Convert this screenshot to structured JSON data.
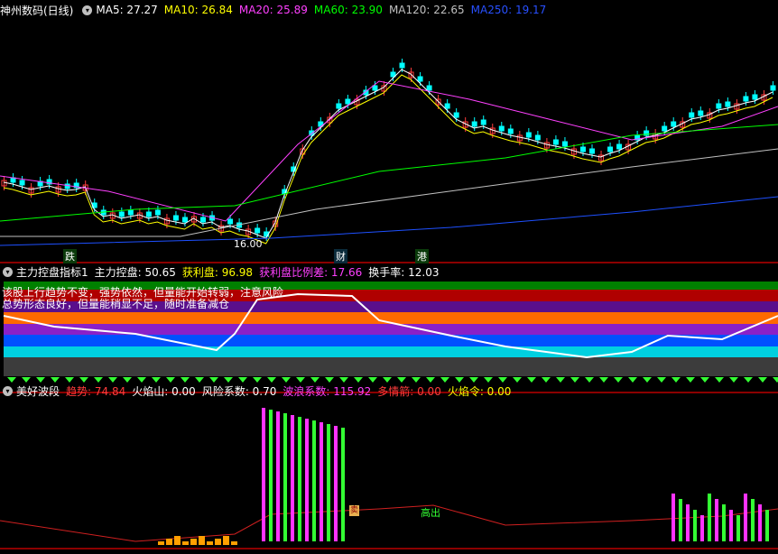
{
  "main": {
    "title": "神州数码(日线)",
    "ma5": "MA5: 27.27",
    "ma10": "MA10: 26.84",
    "ma20": "MA20: 25.89",
    "ma60": "MA60: 23.90",
    "ma120": "MA120: 22.65",
    "ma250": "MA250: 19.17",
    "low_label": "16.00",
    "marks": [
      "跌",
      "财",
      "港"
    ]
  },
  "panel2": {
    "title": "主力控盘指标1",
    "kongpan": "主力控盘: 50.65",
    "huoli": "获利盘: 96.98",
    "bili": "获利盘比例差: 17.66",
    "huanshou": "换手率: 12.03",
    "note1": "该股上行趋势不变，强势依然，但量能开始转弱，注意风险",
    "note2": "总势形态良好，但量能稍显不足，随时准备减仓"
  },
  "panel3": {
    "title": "美好波段",
    "qushi": "趋势: 74.84",
    "huoyanshan": "火焰山: 0.00",
    "fengxian": "风险系数: 0.70",
    "bolang": "波浪系数: 115.92",
    "duoqing": "多情箭: 0.00",
    "huoyanling": "火焰令: 0.00",
    "gaochu": "高出"
  },
  "colors": {
    "ma5": "#ffffff",
    "ma10": "#ffff00",
    "ma20": "#ff40ff",
    "ma60": "#00ff00",
    "ma120": "#c0c0c0",
    "ma250": "#1e50ff",
    "up": "#ff3c3c",
    "down": "#00ffff",
    "magenta": "#ff33ff",
    "green": "#33ff33"
  },
  "icons": [
    "toggle-circle-icon",
    "sell-signal-icon"
  ]
}
